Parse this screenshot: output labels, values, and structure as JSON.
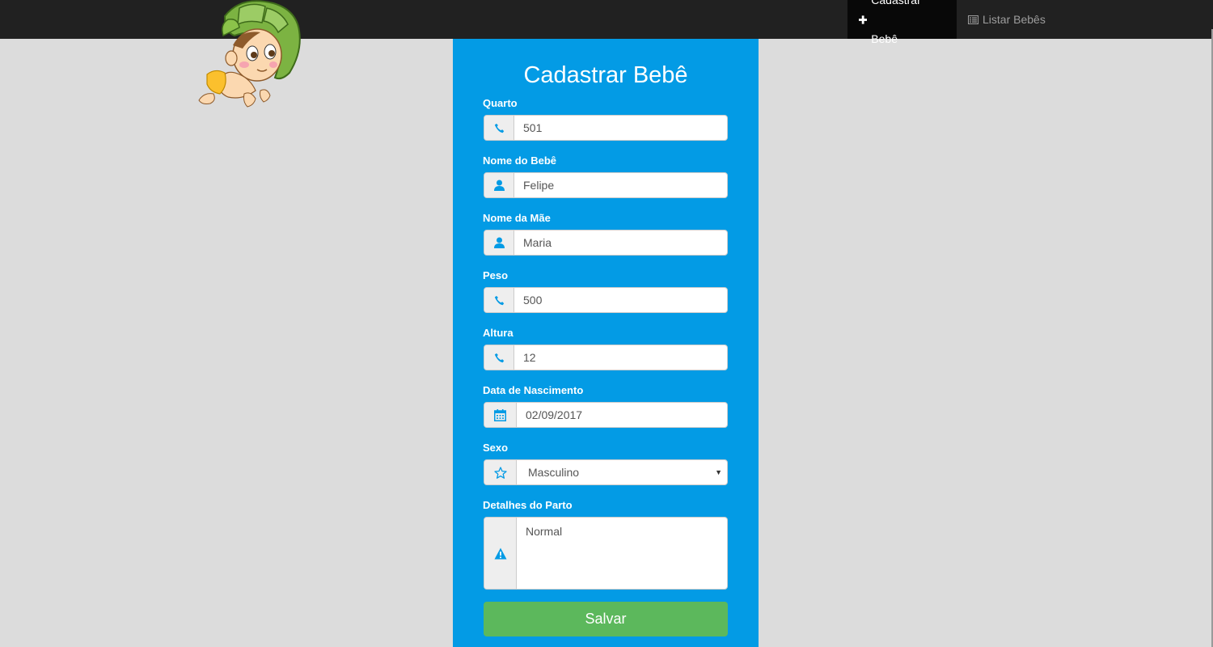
{
  "nav": {
    "items": [
      {
        "label": "Cadastrar Bebê",
        "icon": "plus-icon",
        "active": true
      },
      {
        "label": "Listar Bebês",
        "icon": "list-icon",
        "active": false
      }
    ]
  },
  "form": {
    "title": "Cadastrar Bebê",
    "fields": {
      "quarto": {
        "label": "Quarto",
        "value": "501",
        "icon": "phone-icon"
      },
      "nome_bebe": {
        "label": "Nome do Bebê",
        "value": "Felipe",
        "icon": "user-icon"
      },
      "nome_mae": {
        "label": "Nome da Mãe",
        "value": "Maria",
        "icon": "user-icon"
      },
      "peso": {
        "label": "Peso",
        "value": "500",
        "icon": "phone-icon"
      },
      "altura": {
        "label": "Altura",
        "value": "12",
        "icon": "phone-icon"
      },
      "data_nascimento": {
        "label": "Data de Nascimento",
        "value": "02/09/2017",
        "icon": "calendar-icon"
      },
      "sexo": {
        "label": "Sexo",
        "value": "Masculino",
        "icon": "star-icon"
      },
      "detalhes_parto": {
        "label": "Detalhes do Parto",
        "value": "Normal",
        "icon": "warning-icon"
      }
    },
    "save_label": "Salvar"
  },
  "colors": {
    "navbar": "#212121",
    "panel": "#039be5",
    "save_button": "#5cb85c",
    "icon": "#039be5"
  }
}
